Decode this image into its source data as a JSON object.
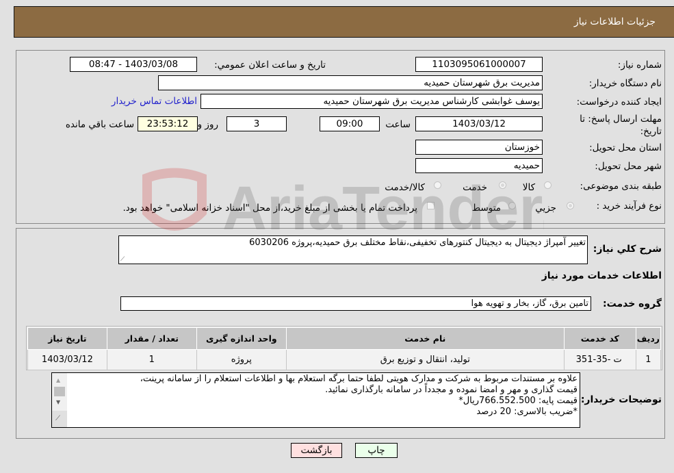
{
  "header": {
    "title": "جزئیات اطلاعات نیاز"
  },
  "fields": {
    "need_number": {
      "label": "شماره نیاز:",
      "value": "1103095061000007"
    },
    "announce_datetime": {
      "label": "تاریخ و ساعت اعلان عمومي:",
      "value": "1403/03/08 - 08:47"
    },
    "buyer_org": {
      "label": "نام دستگاه خریدار:",
      "value": "مدیریت برق شهرستان حمیدیه"
    },
    "requester": {
      "label": "ایجاد کننده درخواست:",
      "value": "یوسف غوابشی کارشناس مدیریت برق شهرستان حمیدیه"
    },
    "buyer_contact_link": "اطلاعات تماس خریدار",
    "deadline": {
      "label": "مهلت ارسال پاسخ: تا تاریخ:",
      "date": "1403/03/12",
      "time_label": "ساعت",
      "time": "09:00",
      "days": "3",
      "days_label": "روز و",
      "remaining": "23:53:12",
      "remaining_label": "ساعت باقي مانده"
    },
    "province": {
      "label": "استان محل تحویل:",
      "value": "خوزستان"
    },
    "city": {
      "label": "شهر محل تحویل:",
      "value": "حمیدیه"
    },
    "category": {
      "label": "طبقه بندی موضوعی:",
      "options": [
        "کالا",
        "خدمت",
        "کالا/خدمت"
      ],
      "selected": "خدمت"
    },
    "purchase_type": {
      "label": "نوع فرآیند خرید :",
      "options": [
        "جزیي",
        "متوسط"
      ],
      "selected": "جزیي",
      "treasury_note": "پرداخت تمام یا بخشی از مبلغ خرید،از محل \"اسناد خزانه اسلامی\" خواهد بود."
    }
  },
  "description": {
    "label": "شرح کلي نیاز:",
    "value": "تغییر آمپراژ دیجیتال به دیجیتال کنتورهای تخفیفی،نقاط مختلف برق حمیدیه،پروژه 6030206"
  },
  "services_section": {
    "title": "اطلاعات خدمات مورد نیاز",
    "group_label": "گروه خدمت:",
    "group_value": "تامین برق، گاز، بخار و تهویه هوا",
    "table": {
      "headers": [
        "ردیف",
        "کد خدمت",
        "نام خدمت",
        "واحد اندازه گیری",
        "تعداد / مقدار",
        "تاریخ نیاز"
      ],
      "rows": [
        [
          "1",
          "ت -35-351",
          "تولید، انتقال و توزیع برق",
          "پروژه",
          "1",
          "1403/03/12"
        ]
      ]
    }
  },
  "buyer_notes": {
    "label": "توضیحات خریدار:",
    "lines": [
      "علاوه بر مستندات مربوط به شرکت و مدارک هویتی لطفا حتما برگه استعلام بها و اطلاعات استعلام را از سامانه پرینت،",
      "قیمت گذاری و مهر و امضا نموده و مجدداً در سامانه بارگذاری نمائید.",
      " قیمت پایه: 766.552.500ریال*",
      "*ضریب بالاسری:  20 درصد"
    ]
  },
  "buttons": {
    "print": "چاپ",
    "back": "بازگشت"
  },
  "colors": {
    "header_bg": "#8c6b42",
    "print_bg": "#eaffea",
    "back_bg": "#ffe0e0",
    "link": "#2222cc"
  }
}
